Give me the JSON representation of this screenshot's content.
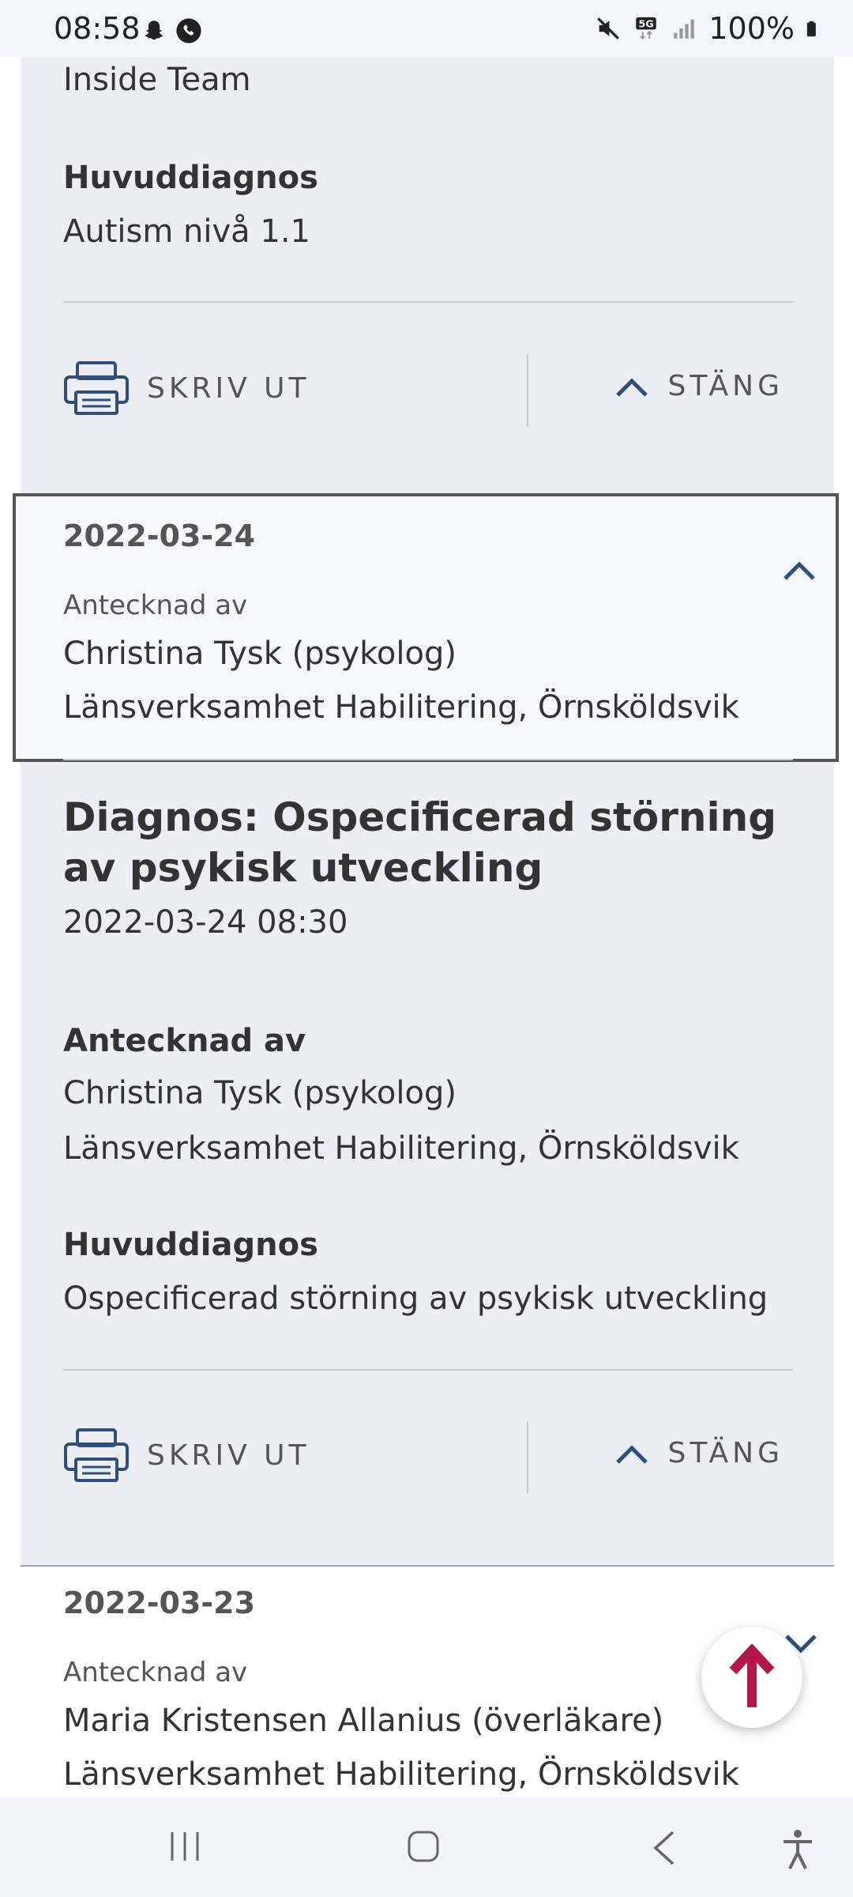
{
  "status_bar": {
    "time": "08:58",
    "battery": "100%",
    "network": "5G",
    "icons": [
      "snapchat-icon",
      "phone-icon",
      "mute-icon",
      "5g-icon",
      "signal-icon",
      "battery-icon"
    ]
  },
  "card_top": {
    "tail_text": "Inside Team",
    "huvuddiagnos_label": "Huvuddiagnos",
    "huvuddiagnos_value": "Autism nivå 1.1",
    "print_label": "SKRIV UT",
    "close_label": "STÄNG"
  },
  "card_0324": {
    "date": "2022-03-24",
    "noted_by_label": "Antecknad av",
    "noted_by_name": "Christina Tysk (psykolog)",
    "noted_by_unit": "Länsverksamhet Habilitering, Örnsköldsvik",
    "title": "Diagnos: Ospecificerad störning av psykisk utveckling",
    "datetime": "2022-03-24 08:30",
    "antecknad_label": "Antecknad av",
    "antecknad_name": "Christina Tysk (psykolog)",
    "antecknad_unit": "Länsverksamhet Habilitering, Örnsköldsvik",
    "huvuddiagnos_label": "Huvuddiagnos",
    "huvuddiagnos_value": "Ospecificerad störning av psykisk utveckling",
    "print_label": "SKRIV UT",
    "close_label": "STÄNG"
  },
  "card_0323": {
    "date": "2022-03-23",
    "noted_by_label": "Antecknad av",
    "noted_by_name": "Maria Kristensen Allanius (överläkare)",
    "noted_by_unit": "Länsverksamhet Habilitering, Örnsköldsvik"
  },
  "colors": {
    "accent_blue": "#2f4f7a",
    "fab_arrow": "#b5154b",
    "card_bg": "#eceef4"
  }
}
